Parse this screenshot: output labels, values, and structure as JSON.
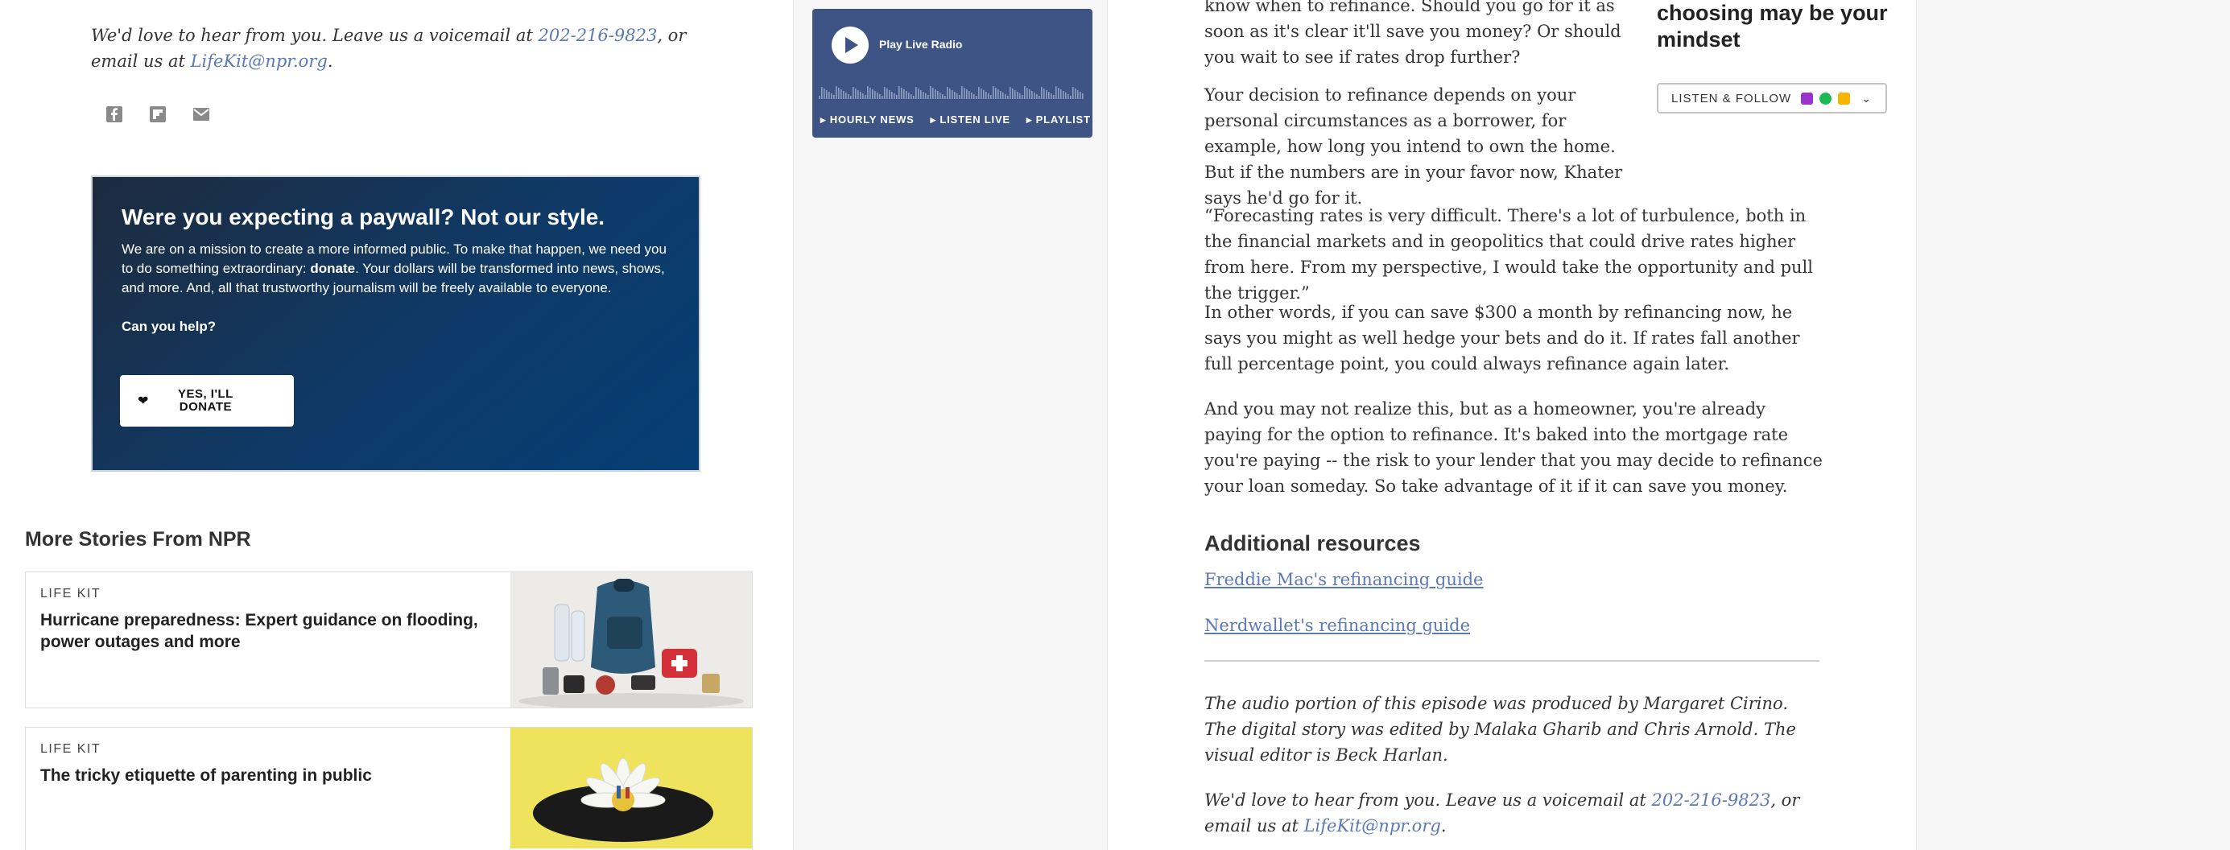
{
  "left": {
    "contact": {
      "pre": "We'd love to hear from you. Leave us a voicemail at ",
      "phone": "202-216-9823",
      "mid": ", or email us at ",
      "email": "LifeKit@npr.org",
      "post": "."
    },
    "share_icons": [
      "facebook-icon",
      "flipboard-icon",
      "email-icon"
    ],
    "paywall": {
      "heading": "Were you expecting a paywall? Not our style.",
      "body_pre": "We are on a mission to create a more informed public. To make that happen, we need you to do something extraordinary: ",
      "body_bold": "donate",
      "body_post": ". Your dollars will be transformed into news, shows, and more. And, all that trustworthy journalism will be freely available to everyone.",
      "question": "Can you help?",
      "button": "YES, I'LL DONATE"
    },
    "more_stories": {
      "heading": "More Stories From NPR",
      "items": [
        {
          "kicker": "LIFE KIT",
          "title": "Hurricane preparedness: Expert guidance on flooding, power outages and more"
        },
        {
          "kicker": "LIFE KIT",
          "title": "The tricky etiquette of parenting in public"
        }
      ]
    }
  },
  "radio": {
    "title": "Play Live Radio",
    "links": [
      "HOURLY NEWS",
      "LISTEN LIVE",
      "PLAYLIST"
    ]
  },
  "article": {
    "p0": "know when to refinance. Should you go for it as soon as it's clear it'll save you money? Or should you wait to see if rates drop further?",
    "p1": "Your decision to refinance depends on your personal circumstances as a borrower, for example, how long you intend to own the home. But if the numbers are in your favor now, Khater says he'd go for it.",
    "p2": "“Forecasting rates is very difficult. There's a lot of turbulence, both in the financial markets and in geopolitics that could drive rates higher from here. From my perspective, I would take the opportunity and pull the trigger.”",
    "p3": "In other words, if you can save $300 a month by refinancing now, he says you might as well hedge your bets and do it. If rates fall another full percentage point, you could always refinance again later.",
    "p4": "And you may not realize this, but as a homeowner, you're already paying for the option to refinance. It's baked into the mortgage rate you're paying -- the risk to your lender that you may decide to refinance your loan someday. So take advantage of it if it can save you money.",
    "resources_heading": "Additional resources",
    "resources": [
      "Freddie Mac's refinancing guide",
      "Nerdwallet's refinancing guide"
    ],
    "credits": "The audio portion of this episode was produced by Margaret Cirino. The digital story was edited by Malaka Gharib and Chris Arnold. The visual editor is Beck Harlan.",
    "contact": {
      "pre": "We'd love to hear from you. Leave us a voicemail at ",
      "phone": "202-216-9823",
      "mid": ", or email us at ",
      "email": "LifeKit@npr.org",
      "post": "."
    }
  },
  "sidebar": {
    "podcast_title": "choosing may be your mindset",
    "listen_follow": "LISTEN & FOLLOW",
    "platform_colors": [
      "#9933cc",
      "#1db954",
      "#f4b400"
    ]
  }
}
